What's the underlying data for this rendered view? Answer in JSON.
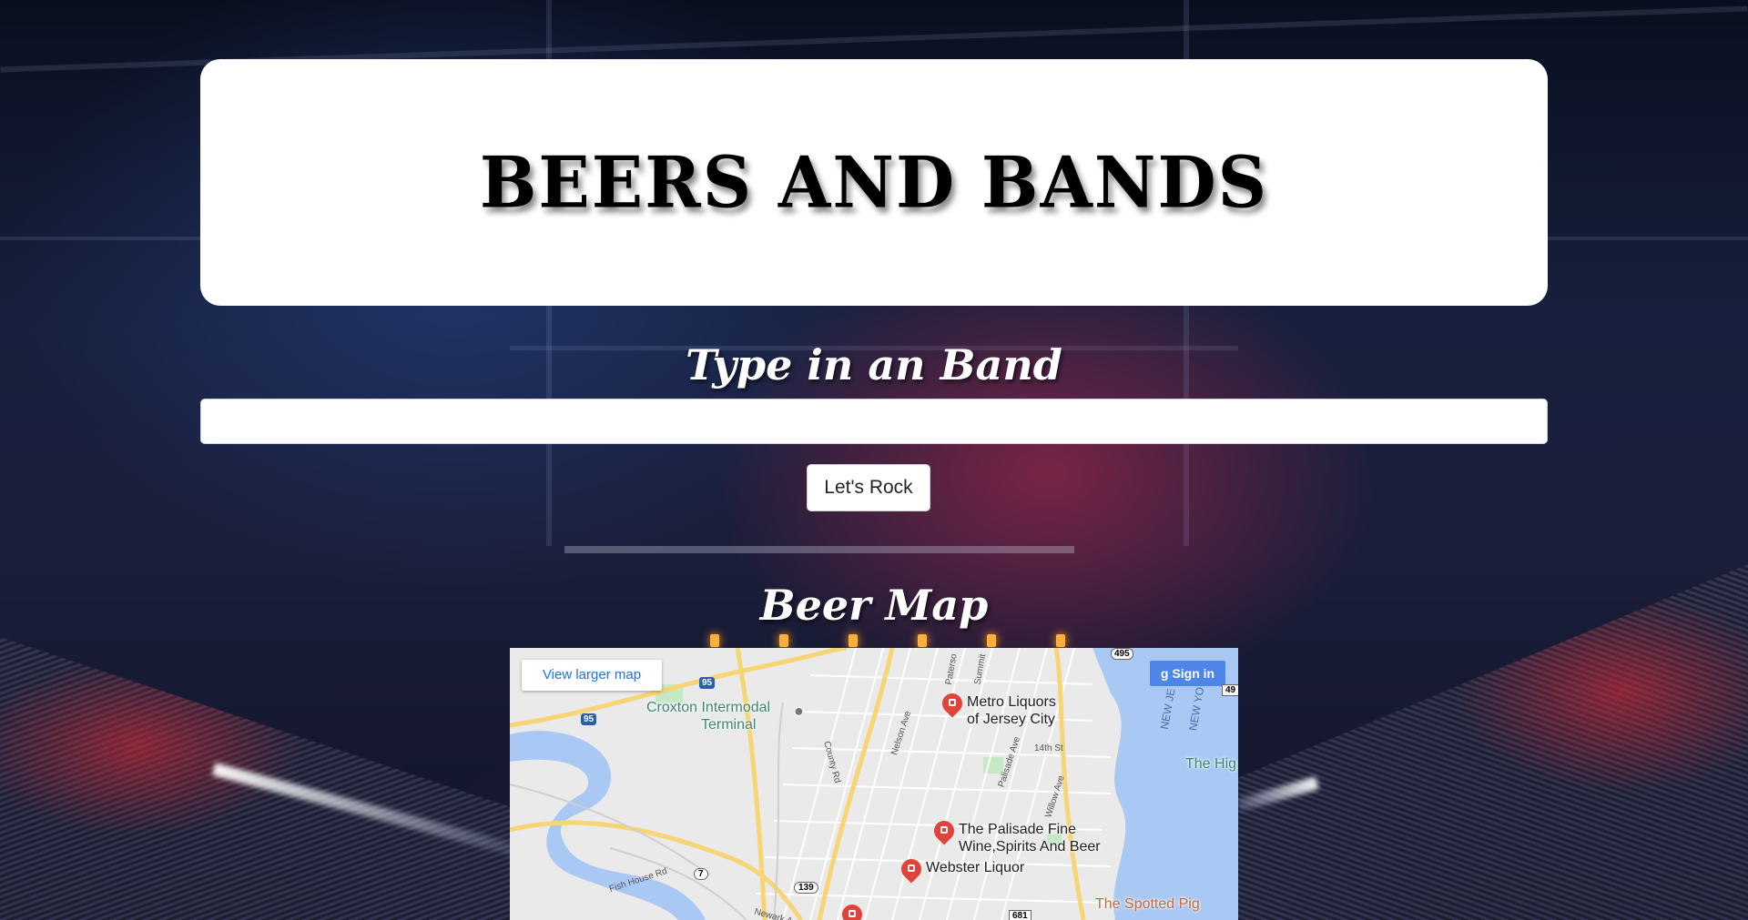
{
  "header": {
    "title": "BEERS AND BANDS"
  },
  "band_search": {
    "heading": "Type in an Band",
    "input_value": "",
    "button_label": "Let's Rock"
  },
  "beer_map": {
    "heading": "Beer Map",
    "view_larger_label": "View larger map",
    "sign_in_label": "Sign in",
    "sign_in_icon": "google-g-icon",
    "places": [
      {
        "name": "Metro Liquors\nof Jersey City",
        "line1": "Metro Liquors",
        "line2": "of Jersey City"
      },
      {
        "name": "The Palisade Fine Wine,Spirits And Beer",
        "line1": "The Palisade Fine",
        "line2": "Wine,Spirits And Beer"
      },
      {
        "name": "Webster Liquor",
        "line1": "Webster Liquor"
      }
    ],
    "labels": {
      "croxton": "Croxton Intermodal",
      "croxton2": "Terminal",
      "high": "The Hig",
      "spotted_pig": "The Spotted Pig"
    },
    "road_labels": {
      "county": "County Rd",
      "fish_house": "Fish House Rd",
      "nelson": "Nelson Ave",
      "palisade": "Palisade Ave",
      "willow": "Willow Ave",
      "st14": "14th St",
      "paterson": "Paterso",
      "summit": "Summit",
      "newark": "Newark A",
      "new_jersey": "NEW JE",
      "new_york": "NEW YO"
    },
    "shields": {
      "i95a": "95",
      "i95b": "95",
      "r7": "7",
      "r139": "139",
      "r681": "681",
      "r495": "495",
      "r9": "49"
    },
    "colors": {
      "water": "#a9c8f4",
      "land": "#eaeaea",
      "road_major": "#f7d574",
      "road_minor": "#ffffff",
      "park": "#c5e8c5",
      "pin": "#e0433a",
      "sign_in": "#4d86e8"
    }
  }
}
